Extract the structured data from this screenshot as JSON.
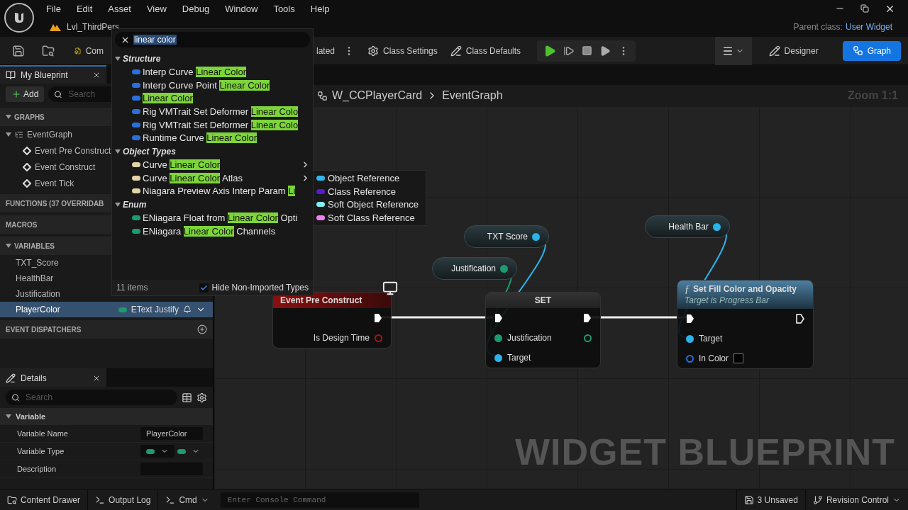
{
  "menu": [
    "File",
    "Edit",
    "Asset",
    "View",
    "Debug",
    "Window",
    "Tools",
    "Help"
  ],
  "doc_tab": {
    "label": "Lvl_ThirdPers"
  },
  "parent_class": {
    "label": "Parent class:",
    "value": "User Widget"
  },
  "toolbar": {
    "compile": "Com",
    "compile_status": "lated",
    "class_settings": "Class Settings",
    "class_defaults": "Class Defaults",
    "modes": [
      {
        "label": "Designer",
        "selected": false
      },
      {
        "label": "Graph",
        "selected": true
      }
    ]
  },
  "my_blueprint": {
    "title": "My Blueprint",
    "add": "Add",
    "search_placeholder": "Search",
    "graphs": {
      "title": "GRAPHS",
      "expanded": true,
      "items": [
        {
          "label": "EventGraph",
          "children": [
            {
              "label": "Event Pre Construct"
            },
            {
              "label": "Event Construct"
            },
            {
              "label": "Event Tick"
            }
          ]
        }
      ]
    },
    "functions": {
      "title": "FUNCTIONS (37 OVERRIDAB"
    },
    "macros": {
      "title": "MACROS"
    },
    "variables": {
      "title": "VARIABLES",
      "expanded": true,
      "items": [
        {
          "name": "TXT_Score",
          "selected": false
        },
        {
          "name": "HealthBar",
          "selected": false
        },
        {
          "name": "Justification",
          "selected": false
        },
        {
          "name": "PlayerColor",
          "selected": true,
          "type": "EText Justify"
        }
      ]
    },
    "dispatchers": {
      "title": "EVENT DISPATCHERS"
    }
  },
  "details": {
    "title": "Details",
    "search_placeholder": "Search",
    "section": "Variable",
    "rows": [
      {
        "label": "Variable Name",
        "kind": "text",
        "value": "PlayerColor"
      },
      {
        "label": "Variable Type",
        "kind": "type"
      },
      {
        "label": "Description",
        "kind": "text"
      }
    ]
  },
  "graph": {
    "breadcrumb": [
      "W_CCPlayerCard",
      "EventGraph"
    ],
    "zoom": "Zoom 1:1",
    "type_label": "WIDGET BLUEPRINT",
    "event_node": {
      "title": "Event Pre Construct",
      "pin": "Is Design Time"
    },
    "getters": [
      {
        "label": "TXT Score",
        "color": "#2ab4ea"
      },
      {
        "label": "Justification",
        "color": "#1d9a70"
      },
      {
        "label": "Health Bar",
        "color": "#2ab4ea"
      }
    ],
    "set_node": {
      "title": "SET",
      "pins": [
        {
          "label": "Justification",
          "color": "#1d9a70"
        },
        {
          "label": "Target",
          "color": "#2ab4ea"
        }
      ]
    },
    "function_node": {
      "glyph": "ƒ",
      "title": "Set Fill Color and Opacity",
      "subtitle": "Target is Progress Bar",
      "pins": [
        {
          "label": "Target",
          "kind": "object"
        },
        {
          "label": "In Color",
          "kind": "color"
        }
      ]
    }
  },
  "picker": {
    "query": "linear color",
    "categories": [
      {
        "name": "Structure",
        "expanded": true,
        "color": "#2a6fdc",
        "items": [
          {
            "before": "Interp Curve ",
            "match": "Linear Color",
            "submenu": false
          },
          {
            "before": "Interp Curve Point ",
            "match": "Linear Color",
            "submenu": false
          },
          {
            "match": "Linear Color",
            "submenu": false
          },
          {
            "before": "Rig VMTrait Set Deformer ",
            "match": "Linear Colo",
            "submenu": false
          },
          {
            "before": "Rig VMTrait Set Deformer ",
            "match": "Linear Colo",
            "submenu": false
          },
          {
            "before": "Runtime Curve ",
            "match": "Linear Color",
            "submenu": false
          }
        ]
      },
      {
        "name": "Object Types",
        "expanded": true,
        "color": "#e4d2a8",
        "items": [
          {
            "before": "Curve ",
            "match": "Linear Color",
            "submenu": true
          },
          {
            "before": "Curve ",
            "match": "Linear Color",
            "after": " Atlas",
            "submenu": true
          },
          {
            "before": "Niagara Preview Axis Interp Param ",
            "match": "Li",
            "submenu": false
          }
        ]
      },
      {
        "name": "Enum",
        "expanded": true,
        "color": "#1d9a70",
        "items": [
          {
            "before": "ENiagara Float from ",
            "match": "Linear Color",
            "after": " Opti",
            "submenu": false
          },
          {
            "before": "ENiagara ",
            "match": "Linear Color",
            "after": " Channels",
            "submenu": false
          }
        ]
      }
    ],
    "count": "11 items",
    "hide_non_imported": {
      "label": "Hide Non-Imported Types",
      "checked": true
    }
  },
  "submenu": [
    {
      "label": "Object Reference",
      "color": "#2fb8f0"
    },
    {
      "label": "Class Reference",
      "color": "#5a1bd0"
    },
    {
      "label": "Soft Object Reference",
      "color": "#80f0f0"
    },
    {
      "label": "Soft Class Reference",
      "color": "#f080f0"
    }
  ],
  "status_bar": {
    "content_drawer": "Content Drawer",
    "output_log": "Output Log",
    "cmd": "Cmd",
    "console_placeholder": "Enter Console Command",
    "unsaved": "3 Unsaved",
    "revision": "Revision Control"
  }
}
